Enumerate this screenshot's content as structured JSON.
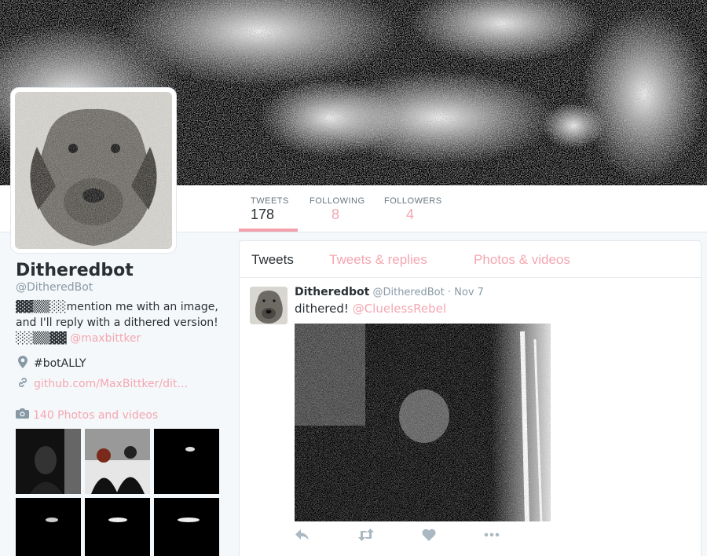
{
  "nav": {
    "tweets": {
      "label": "TWEETS",
      "value": "178"
    },
    "following": {
      "label": "FOLLOWING",
      "value": "8"
    },
    "followers": {
      "label": "FOLLOWERS",
      "value": "4"
    }
  },
  "profile": {
    "name": "Ditheredbot",
    "handle": "@DitheredBot",
    "bio_prefix": "▓▓▒▒░░mention me with an image, and I'll reply with a dithered version!░░▒▒▓▓",
    "bio_mention": "@maxbittker",
    "location": "#botALLY",
    "url": "github.com/MaxBittker/dit…"
  },
  "photos": {
    "label": "140 Photos and videos"
  },
  "tabs": [
    "Tweets",
    "Tweets & replies",
    "Photos & videos"
  ],
  "tweet": {
    "name": "Ditheredbot",
    "handle": "@DitheredBot",
    "date": "Nov 7",
    "text": "dithered!",
    "mention": "@CluelessRebel"
  },
  "icons": {
    "location": "map-pin-icon",
    "link": "link-icon",
    "camera": "camera-icon",
    "reply": "reply-icon",
    "retweet": "retweet-icon",
    "like": "heart-icon",
    "more": "more-icon"
  },
  "colors": {
    "accent": "#f4a7b1",
    "underline": "#f3a2ad",
    "text": "#292f33",
    "muted": "#8899a6"
  }
}
